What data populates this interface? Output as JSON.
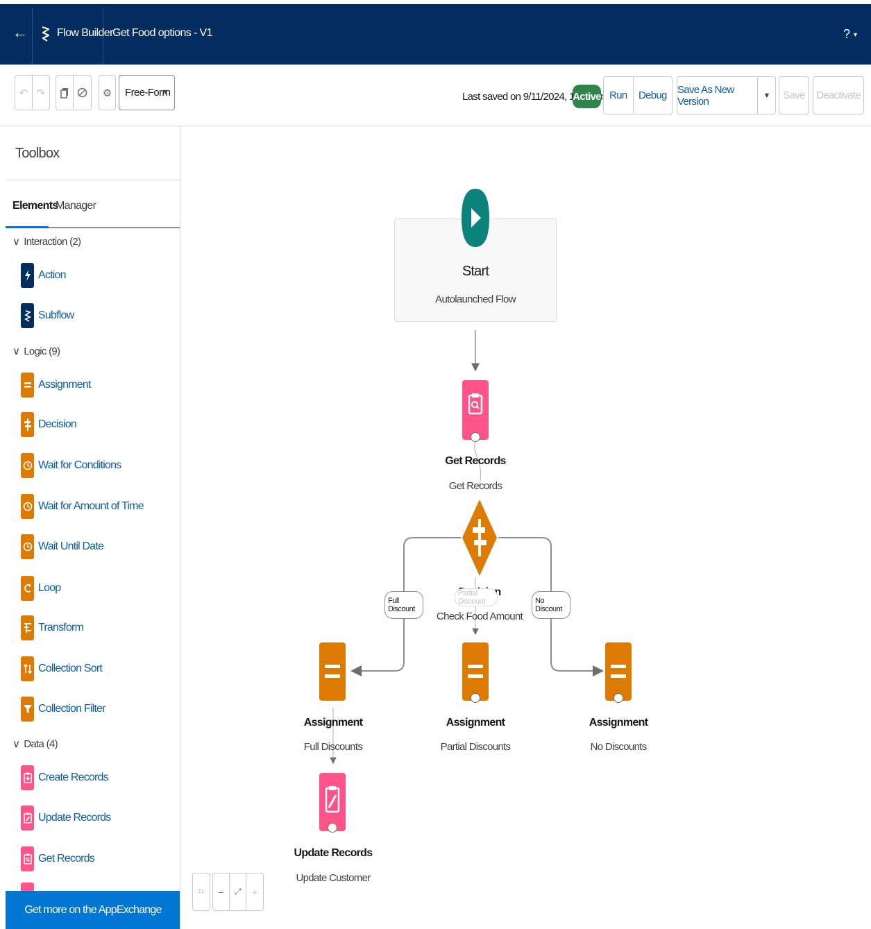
{
  "header": {
    "app_name": "Flow Builder",
    "flow_name": "Get Food options - V1",
    "help_label": "?"
  },
  "toolbar": {
    "mode_select": "Free-Form",
    "last_saved": "Last saved on 9/11/2024, 10:12 am",
    "status_badge": "Active",
    "run_label": "Run",
    "debug_label": "Debug",
    "save_as_new_label": "Save As New Version",
    "save_label": "Save",
    "deactivate_label": "Deactivate"
  },
  "toolbox": {
    "title": "Toolbox",
    "tabs": [
      "Elements",
      "Manager"
    ],
    "sections": [
      {
        "label": "Interaction (2)",
        "items": [
          {
            "label": "Action",
            "icon": "lightning-icon",
            "color": "#032d60"
          },
          {
            "label": "Subflow",
            "icon": "subflow-icon",
            "color": "#032d60"
          }
        ]
      },
      {
        "label": "Logic (9)",
        "items": [
          {
            "label": "Assignment",
            "icon": "assignment-icon",
            "color": "#dd7a01"
          },
          {
            "label": "Decision",
            "icon": "decision-icon",
            "color": "#dd7a01"
          },
          {
            "label": "Wait for Conditions",
            "icon": "clock-icon",
            "color": "#dd7a01"
          },
          {
            "label": "Wait for Amount of Time",
            "icon": "clock-icon",
            "color": "#dd7a01"
          },
          {
            "label": "Wait Until Date",
            "icon": "clock-icon",
            "color": "#dd7a01"
          },
          {
            "label": "Loop",
            "icon": "loop-icon",
            "color": "#dd7a01"
          },
          {
            "label": "Transform",
            "icon": "transform-icon",
            "color": "#dd7a01"
          },
          {
            "label": "Collection Sort",
            "icon": "sort-icon",
            "color": "#dd7a01"
          },
          {
            "label": "Collection Filter",
            "icon": "filter-icon",
            "color": "#dd7a01"
          }
        ]
      },
      {
        "label": "Data (4)",
        "items": [
          {
            "label": "Create Records",
            "icon": "create-records-icon",
            "color": "#ff538a"
          },
          {
            "label": "Update Records",
            "icon": "update-records-icon",
            "color": "#ff538a"
          },
          {
            "label": "Get Records",
            "icon": "get-records-icon",
            "color": "#ff538a"
          }
        ]
      }
    ],
    "appexchange_label": "Get more on the AppExchange"
  },
  "canvas": {
    "start": {
      "type": "Start",
      "name": "Autolaunched Flow"
    },
    "get_records": {
      "type": "Get Records",
      "name": "Get Records"
    },
    "decision": {
      "type": "Decision",
      "name": "Check Food Amount"
    },
    "branches": {
      "left": "Full Discount",
      "middle": "Partial Discount",
      "right": "No Discount"
    },
    "assignments": [
      {
        "type": "Assignment",
        "name": "Full Discounts"
      },
      {
        "type": "Assignment",
        "name": "Partial Discounts"
      },
      {
        "type": "Assignment",
        "name": "No Discounts"
      }
    ],
    "update_records": {
      "type": "Update Records",
      "name": "Update Customer"
    }
  },
  "colors": {
    "header_bg": "#032d60",
    "brand_blue": "#0176d3",
    "link_blue": "#0b5cab",
    "active_green": "#2e844a",
    "start_teal": "#0b827c",
    "logic_orange": "#dd7a01",
    "data_pink": "#ff538a"
  }
}
